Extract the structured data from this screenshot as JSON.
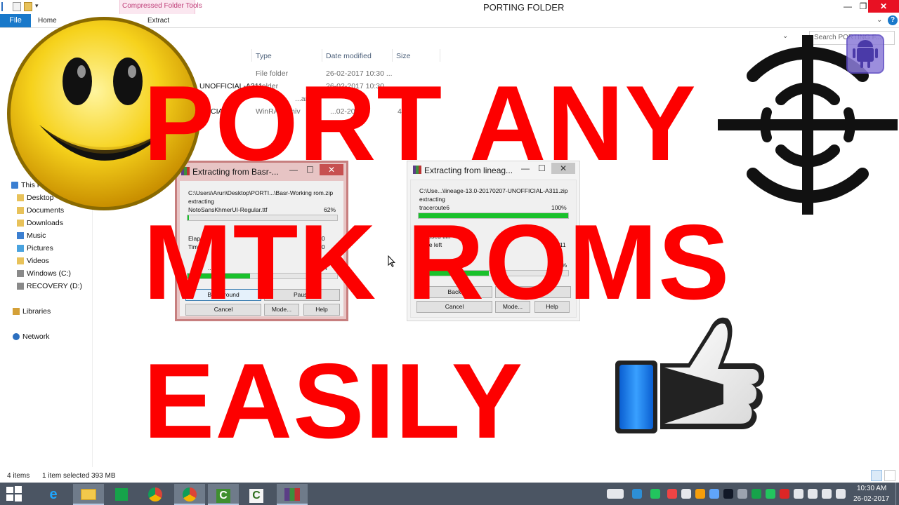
{
  "window": {
    "title": "PORTING FOLDER",
    "context_tab": "Compressed Folder Tools",
    "minimize": "—",
    "maximize": "❐",
    "close": "✕"
  },
  "ribbon": {
    "file": "File",
    "home": "Home",
    "extract": "Extract",
    "collapse": "⌄",
    "help": "?"
  },
  "address": {
    "dropdown": "⌄",
    "search_placeholder": "Search PORTING F..."
  },
  "nav": {
    "items": [
      {
        "label": "This PC",
        "icon": "pc-icon"
      },
      {
        "label": "Desktop",
        "icon": "folder-icon"
      },
      {
        "label": "Documents",
        "icon": "folder-icon"
      },
      {
        "label": "Downloads",
        "icon": "folder-icon"
      },
      {
        "label": "Music",
        "icon": "music-icon"
      },
      {
        "label": "Pictures",
        "icon": "pictures-icon"
      },
      {
        "label": "Videos",
        "icon": "folder-icon"
      },
      {
        "label": "Windows (C:)",
        "icon": "drive-icon"
      },
      {
        "label": "RECOVERY (D:)",
        "icon": "drive-icon"
      },
      {
        "label": "Libraries",
        "icon": "libraries-icon"
      },
      {
        "label": "Network",
        "icon": "network-icon"
      }
    ]
  },
  "file_list": {
    "columns": [
      "Type",
      "Date modified",
      "Size"
    ],
    "rows": [
      {
        "name": "",
        "type": "File folder",
        "date": "26-02-2017 10:30 ...",
        "size": ""
      },
      {
        "name": "UNOFFICIAL-A311",
        "type": "...older",
        "date": "26-02-2017 10:30 ...",
        "size": ""
      },
      {
        "name": "",
        "type": "...archiv",
        "date": "",
        "size": ""
      },
      {
        "name": "CIA",
        "type": "WinRA...rchiv",
        "date": "...02-201...",
        "size": "4,03"
      }
    ]
  },
  "status": {
    "items": "4 items",
    "selected": "1 item selected  393 MB"
  },
  "dialog_left": {
    "title": "Extracting from Basr-...",
    "path": "C:\\Users\\Arun\\Desktop\\PORTI...\\Basr-Working rom.zip",
    "action": "extracting",
    "file": "NotoSansKhmerUI-Regular.ttf",
    "file_percent": "62%",
    "file_progress": 0.01,
    "elapsed_label": "Elaps",
    "time_label": "Tim",
    "elapsed_value": "00:0",
    "time_value": "00:0",
    "processed_label": "...ed",
    "processed_percent": "4",
    "processed_progress": 0.42,
    "btn_background": "Background",
    "btn_pause": "Pause",
    "btn_cancel": "Cancel",
    "btn_mode": "Mode...",
    "btn_help": "Help"
  },
  "dialog_right": {
    "title": "Extracting from lineag...",
    "path": "C:\\Use...\\lineage-13.0-20170207-UNOFFICIAL-A311.zip",
    "action": "extracting",
    "file": "traceroute6",
    "file_percent": "100%",
    "file_progress": 1.0,
    "elapsed_label": "Elapsed tim",
    "time_label": "Time left",
    "time_value": "00:11",
    "processed_label": "Processed",
    "processed_percent": "47%",
    "processed_progress": 0.47,
    "btn_background": "Back",
    "btn_pause": "Pause",
    "btn_cancel": "Cancel",
    "btn_mode": "Mode...",
    "btn_help": "Help"
  },
  "overlay": {
    "line1": "PORT ANY",
    "line2": "MTK ROMS",
    "line3": "EASILY",
    "color": "#fd0000"
  },
  "taskbar": {
    "apps": [
      "windows-start-icon",
      "internet-explorer-icon",
      "file-explorer-icon",
      "store-icon",
      "chrome-icon",
      "chrome-icon",
      "camtasia-icon",
      "camtasia-icon",
      "winrar-icon"
    ],
    "time": "10:30 AM",
    "date": "26-02-2017"
  },
  "colors": {
    "accent": "#1979ca",
    "taskbar": "#4b5563",
    "progress": "#19c12b"
  }
}
